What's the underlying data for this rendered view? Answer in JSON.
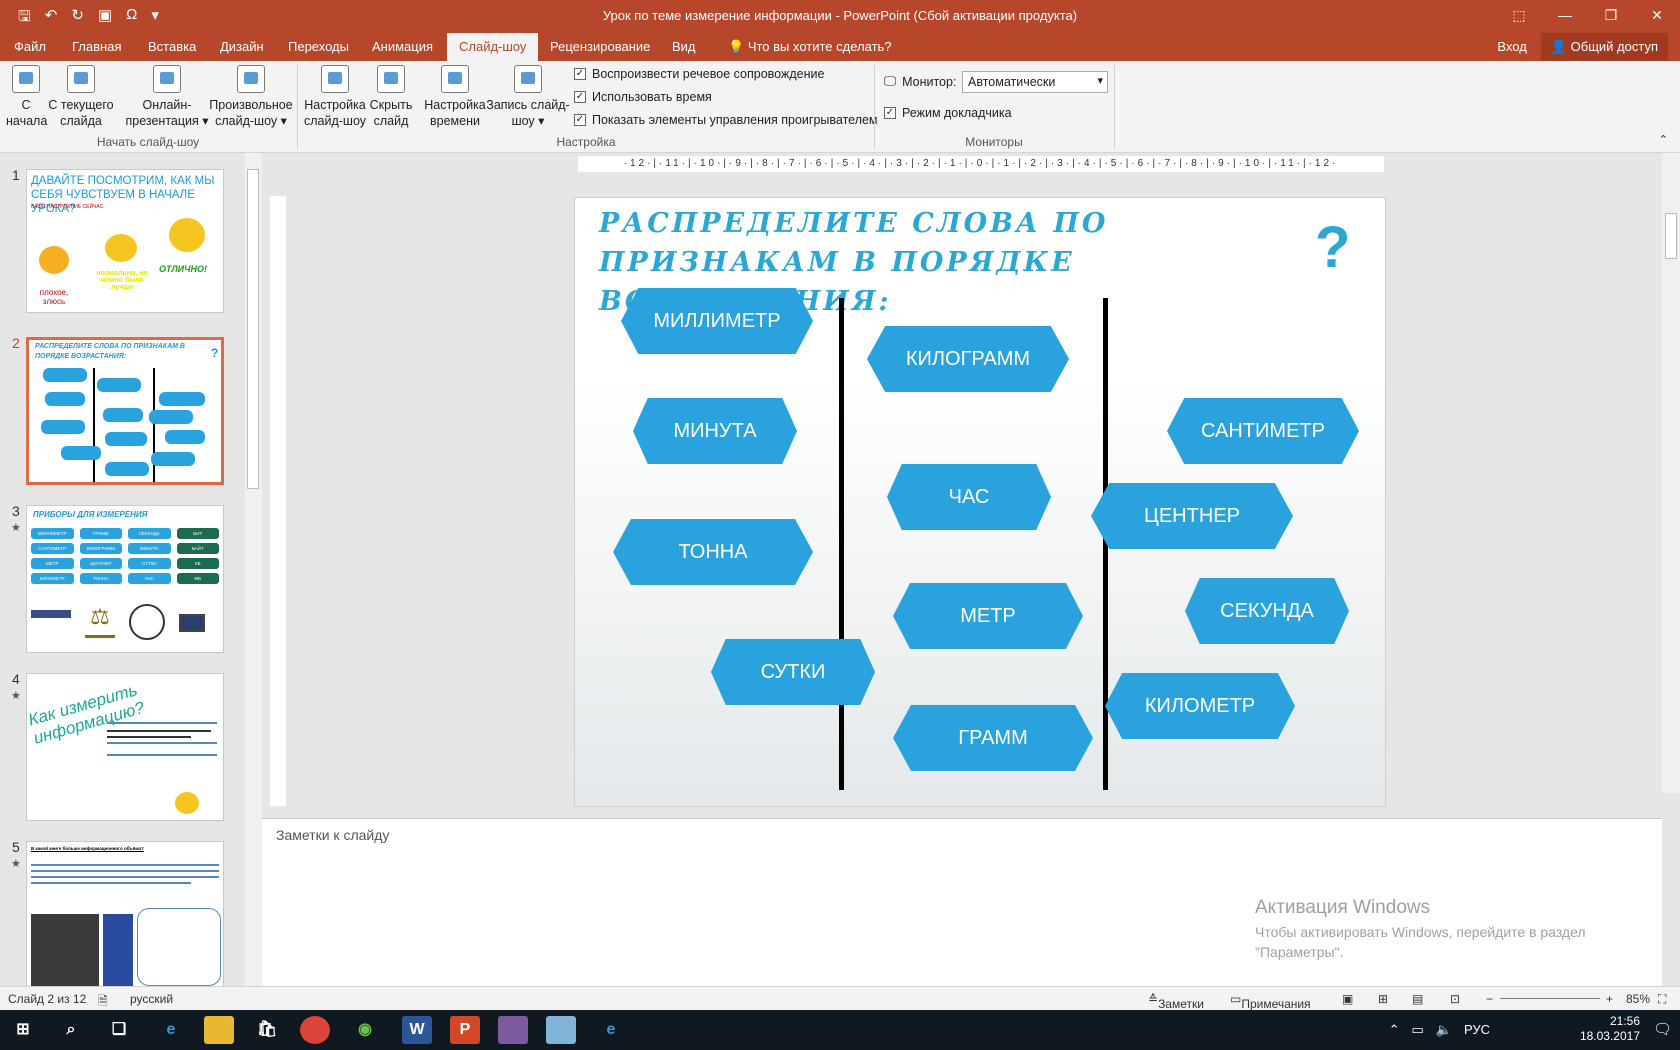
{
  "app": {
    "title": "Урок по теме измерение информации - PowerPoint (Сбой активации продукта)",
    "qa_icons": [
      "save-icon",
      "undo-icon",
      "redo-icon",
      "presentation-icon",
      "omega-icon",
      "customize-icon"
    ],
    "window_buttons": [
      "⬚",
      "—",
      "❐",
      "✕"
    ]
  },
  "tabs": [
    "Файл",
    "Главная",
    "Вставка",
    "Дизайн",
    "Переходы",
    "Анимация",
    "Слайд-шоу",
    "Рецензирование",
    "Вид"
  ],
  "active_tab": "Слайд-шоу",
  "tell_me": "Что вы хотите сделать?",
  "signin": "Вход",
  "share": "Общий доступ",
  "ribbon": {
    "buttons": [
      {
        "line1": "С",
        "line2": "начала"
      },
      {
        "line1": "С текущего",
        "line2": "слайда"
      },
      {
        "line1": "Онлайн-",
        "line2": "презентация ▾"
      },
      {
        "line1": "Произвольное",
        "line2": "слайд-шоу ▾"
      },
      {
        "line1": "Настройка",
        "line2": "слайд-шоу"
      },
      {
        "line1": "Скрыть",
        "line2": "слайд"
      },
      {
        "line1": "Настройка",
        "line2": "времени"
      },
      {
        "line1": "Запись слайд-",
        "line2": "шоу ▾"
      }
    ],
    "groups": [
      "Начать слайд-шоу",
      "Настройка",
      "Мониторы"
    ],
    "checkboxes": [
      "Воспроизвести речевое сопровождение",
      "Использовать время",
      "Показать элементы управления проигрывателем"
    ],
    "monitor_label": "Монитор:",
    "monitor_value": "Автоматически",
    "presenter_view": "Режим докладчика"
  },
  "thumbnails": [
    {
      "num": "1",
      "star": "",
      "title": "ДАВАЙТЕ ПОСМОТРИМ, КАК МЫ СЕБЯ ЧУВСТВУЕМ В НАЧАЛЕ УРОКА?",
      "sub": "ВАШЕ НАСТРОЕНИЕ СЕЙЧАС:",
      "labels": [
        "плохое, злюсь",
        "нормально, но можно было лучше",
        "ОТЛИЧНО!"
      ]
    },
    {
      "num": "2",
      "star": "",
      "title": "РАСПРЕДЕЛИТЕ СЛОВА ПО ПРИЗНАКАМ В ПОРЯДКЕ ВОЗРАСТАНИЯ:"
    },
    {
      "num": "3",
      "star": "★",
      "title": "ПРИБОРЫ ДЛЯ ИЗМЕРЕНИЯ",
      "cells": [
        "МИЛЛИМЕТР",
        "ГРАММ",
        "СЕКУНДА",
        "БИТ",
        "САНТИМЕТР",
        "КИЛОГРАММ",
        "МИНУТА",
        "БАЙТ",
        "МЕТР",
        "ЦЕНТНЕР",
        "СУТКИ",
        "КБ",
        "КИЛОМЕТР",
        "ТОННА",
        "ЧАС",
        "МБ"
      ]
    },
    {
      "num": "4",
      "star": "★",
      "title": "Как измерить информацию?"
    },
    {
      "num": "5",
      "star": "★",
      "title": "В какой книге больше информационного объёма?"
    }
  ],
  "slide": {
    "title": "РАСПРЕДЕЛИТЕ СЛОВА ПО ПРИЗНАКАМ В ПОРЯДКЕ ВОЗРАСТАНИЯ:",
    "qmark": "?",
    "words": [
      "МИЛЛИМЕТР",
      "МИНУТА",
      "ТОННА",
      "СУТКИ",
      "КИЛОГРАММ",
      "ЧАС",
      "МЕТР",
      "ГРАММ",
      "САНТИМЕТР",
      "ЦЕНТНЕР",
      "СЕКУНДА",
      "КИЛОМЕТР"
    ]
  },
  "ruler": "·12·|·11·|·10·|·9·|·8·|·7·|·6·|·5·|·4·|·3·|·2·|·1·|·0·|·1·|·2·|·3·|·4·|·5·|·6·|·7·|·8·|·9·|·10·|·11·|·12·",
  "notes_placeholder": "Заметки к слайду",
  "activation": {
    "line1": "Активация Windows",
    "line2": "Чтобы активировать Windows, перейдите в раздел",
    "line3": "\"Параметры\"."
  },
  "status": {
    "slide": "Слайд 2 из 12",
    "lang": "русский",
    "notes": "Заметки",
    "comments": "Примечания",
    "zoom": "85%"
  },
  "taskbar": {
    "time": "21:56",
    "date": "18.03.2017",
    "lang": "РУС"
  }
}
